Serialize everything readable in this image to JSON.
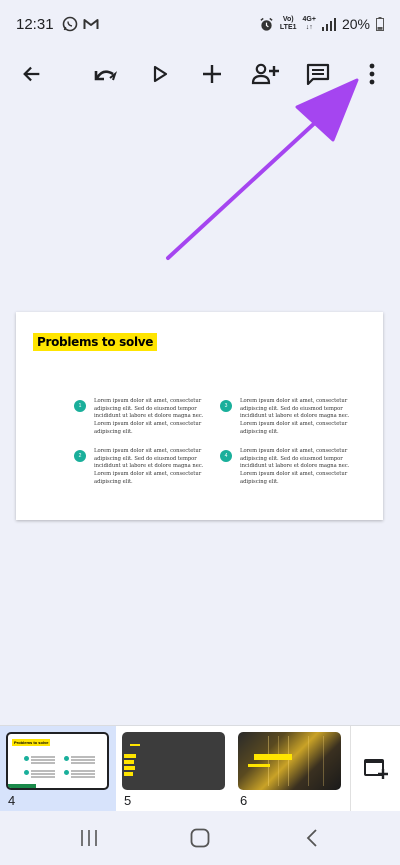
{
  "status_bar": {
    "time": "12:31",
    "battery": "20%",
    "network_top": "Vo)",
    "network_bottom": "LTE1",
    "gen": "4G+"
  },
  "toolbar": {
    "icons": [
      "back-arrow-icon",
      "undo-icon",
      "play-icon",
      "add-icon",
      "add-person-icon",
      "comment-icon",
      "more-vert-icon"
    ]
  },
  "slide": {
    "title": "Problems to solve",
    "points": [
      {
        "n": "1",
        "text": "Lorem ipsum dolor sit amet, consectetur adipiscing elit. Sed do eiusmod tempor incididunt ut labore et dolore magna nec. Lorem ipsum dolor sit amet, consectetur adipiscing elit."
      },
      {
        "n": "2",
        "text": "Lorem ipsum dolor sit amet, consectetur adipiscing elit. Sed do eiusmod tempor incididunt ut labore et dolore magna nec. Lorem ipsum dolor sit amet, consectetur adipiscing elit."
      },
      {
        "n": "3",
        "text": "Lorem ipsum dolor sit amet, consectetur adipiscing elit. Sed do eiusmod tempor incididunt ut labore et dolore magna nec. Lorem ipsum dolor sit amet, consectetur adipiscing elit."
      },
      {
        "n": "4",
        "text": "Lorem ipsum dolor sit amet, consectetur adipiscing elit. Sed do eiusmod tempor incididunt ut labore et dolore magna nec. Lorem ipsum dolor sit amet, consectetur adipiscing elit."
      }
    ]
  },
  "filmstrip": {
    "thumbs": [
      {
        "num": "4",
        "label": "Problems to solve"
      },
      {
        "num": "5"
      },
      {
        "num": "6"
      }
    ]
  },
  "colors": {
    "accent_yellow": "#ffe500",
    "teal": "#1aaf9b",
    "annotation_arrow": "#a545f0",
    "active_thumb_bg": "#d7e3fb"
  }
}
